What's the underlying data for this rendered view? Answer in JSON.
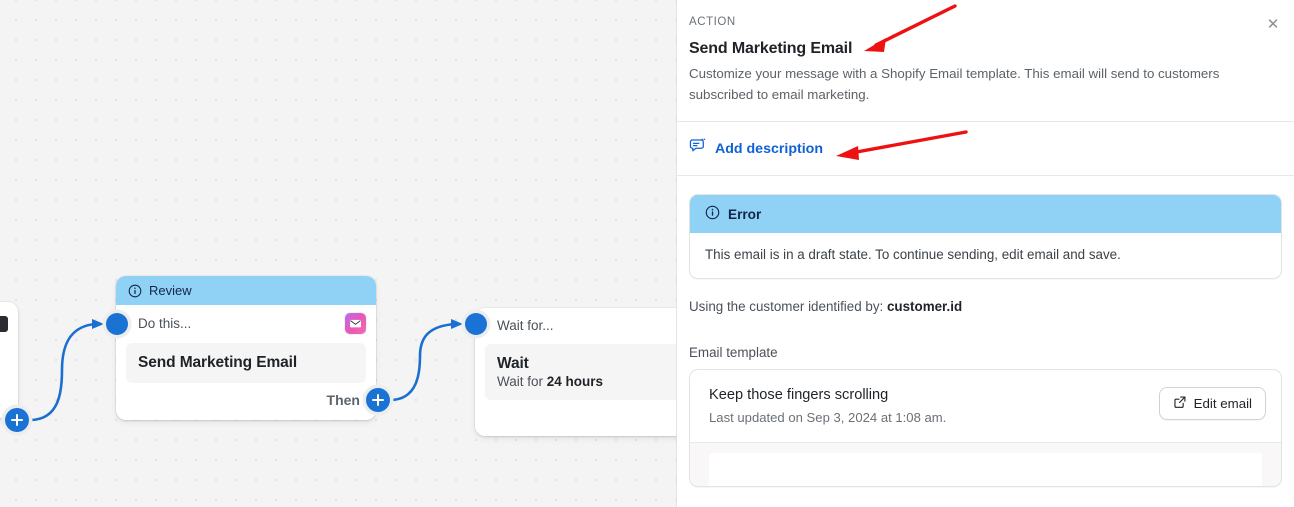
{
  "canvas": {
    "nodes": [
      {
        "banner_label": "Review",
        "banner_icon": "info-circle-icon",
        "row_label": "Do this...",
        "badge_icon": "envelope-icon",
        "title": "Send Marketing Email",
        "then_label": "Then"
      },
      {
        "row_label": "Wait for...",
        "title": "Wait",
        "sub_prefix": "Wait for ",
        "sub_value": "24 hours"
      }
    ],
    "add_step_label": "+",
    "accent_color": "#1a73d4",
    "banner_color": "#8fd2f5"
  },
  "panel": {
    "eyebrow": "ACTION",
    "title": "Send Marketing Email",
    "description": "Customize your message with a Shopify Email template. This email will send to customers subscribed to email marketing.",
    "close_label": "✕",
    "add_description_label": "Add description",
    "add_description_icon": "comment-edit-icon",
    "link_color": "#0f62d6",
    "error": {
      "heading": "Error",
      "icon": "info-circle-icon",
      "message": "This email is in a draft state. To continue sending, edit email and save.",
      "header_color": "#8fd2f5"
    },
    "customer_identified_prefix": "Using the customer identified by: ",
    "customer_identified_value": "customer.id",
    "email_template_label": "Email template",
    "template": {
      "name": "Keep those fingers scrolling",
      "last_updated": "Last updated on Sep 3, 2024 at 1:08 am.",
      "edit_button_label": "Edit email",
      "edit_button_icon": "external-link-icon"
    }
  },
  "annotations": {
    "color": "#ee1111",
    "arrows": [
      {
        "name": "arrow-to-title"
      },
      {
        "name": "arrow-to-add-description"
      }
    ]
  }
}
